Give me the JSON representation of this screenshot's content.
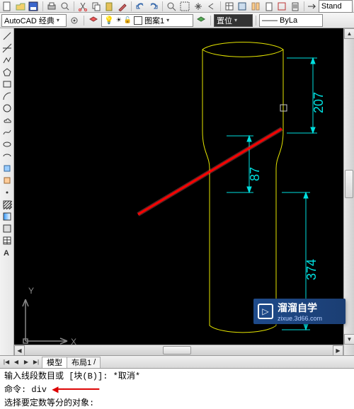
{
  "toolbar1": {
    "icons": [
      "new",
      "open",
      "save",
      "print",
      "undo",
      "redo",
      "cut",
      "copy",
      "paste",
      "match",
      "eraser",
      "zoom-ext",
      "zoom-win",
      "pan",
      "zoom-prev",
      "props",
      "sheet",
      "layer1",
      "layer2",
      "layer3",
      "layer4",
      "arrow",
      "dim-style"
    ],
    "dimstyle_label": "Stand"
  },
  "toolbar2": {
    "workspace": "AutoCAD 经典",
    "layer_current": "图案1",
    "linetype": "—— ByLa",
    "color_label": "置位"
  },
  "dims": {
    "d1": "207",
    "d2": "87",
    "d3": "374"
  },
  "axes": {
    "x": "X",
    "y": "Y"
  },
  "tabs": {
    "model": "模型",
    "layout1": "布局1"
  },
  "cmd": {
    "line1_a": "输入线段数目或 [块(B)]: ",
    "line1_b": "*取消*",
    "line2_a": "命令: ",
    "line2_b": "div",
    "line3": "选择要定数等分的对象:"
  },
  "watermark": {
    "title": "溜溜自学",
    "sub": "zixue.3d66.com",
    "icon": "▷"
  },
  "vtool_names": [
    "line",
    "xline",
    "pline",
    "polygon",
    "rect",
    "arc",
    "circle",
    "spline",
    "ellipse",
    "ellipse-arc",
    "block-insert",
    "block-make",
    "point",
    "hatch",
    "region",
    "table",
    "mtext",
    "addition"
  ]
}
